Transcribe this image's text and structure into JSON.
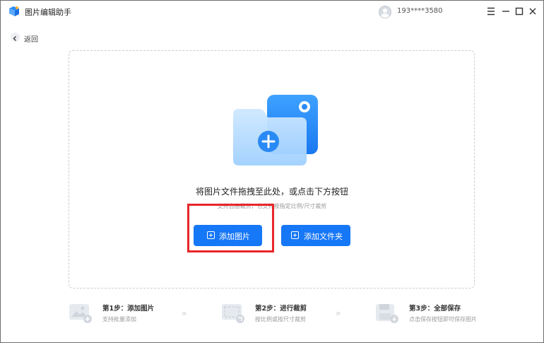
{
  "window": {
    "app_title": "图片编辑助手",
    "user_phone": "193****3580",
    "controls": [
      "menu-icon",
      "minimize-icon",
      "maximize-icon",
      "close-icon"
    ]
  },
  "nav": {
    "back_label": "返回"
  },
  "dropzone": {
    "title": "将图片文件拖拽至此处，或点击下方按钮",
    "subtitle": "支持自由裁剪，也支持按指定比例/尺寸裁剪",
    "add_image_button": "添加图片",
    "add_folder_button": "添加文件夹"
  },
  "steps": [
    {
      "title": "第1步：添加图片",
      "desc": "支持批量添加",
      "icon": "image-add-icon"
    },
    {
      "title": "第2步：进行裁剪",
      "desc": "按比例或按尺寸裁剪",
      "icon": "crop-icon"
    },
    {
      "title": "第3步：全部保存",
      "desc": "点击保存按钮即可保存图片",
      "icon": "save-icon"
    }
  ],
  "colors": {
    "primary": "#1677f7",
    "highlight_border": "#e8262a",
    "dashed_border": "#c8ccd2"
  }
}
